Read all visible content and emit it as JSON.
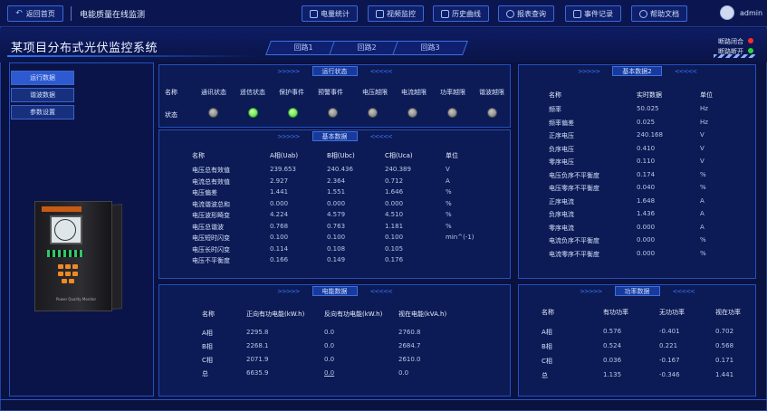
{
  "topbar": {
    "back_label": "返回首页",
    "device_title": "电能质量在线监测",
    "nav": [
      {
        "label": "电量统计",
        "icon": "chart-icon"
      },
      {
        "label": "视频监控",
        "icon": "video-icon"
      },
      {
        "label": "历史曲线",
        "icon": "history-icon"
      },
      {
        "label": "报表查询",
        "icon": "search-icon"
      },
      {
        "label": "事件记录",
        "icon": "document-icon"
      },
      {
        "label": "帮助文档",
        "icon": "help-icon"
      }
    ],
    "user_name": "admin",
    "user_display": "admin"
  },
  "header": {
    "system_title": "某项目分布式光伏监控系统",
    "lines": [
      "回路1",
      "回路2",
      "回路3"
    ],
    "legend": [
      {
        "label": "断路闭合",
        "color": "#ff2b2b"
      },
      {
        "label": "断路断开",
        "color": "#22d93a"
      }
    ]
  },
  "sidebar": {
    "tabs": [
      "运行数据",
      "谐波数据",
      "参数设置"
    ],
    "device_caption": "Power Quality Monitor"
  },
  "status_panel": {
    "title": "运行状态",
    "row_name_label": "名称",
    "row_status_label": "状态",
    "items": [
      {
        "label": "通讯状态",
        "on": false
      },
      {
        "label": "遥信状态",
        "on": true
      },
      {
        "label": "保护事件",
        "on": true
      },
      {
        "label": "预警事件",
        "on": false
      },
      {
        "label": "电压越限",
        "on": false
      },
      {
        "label": "电流越限",
        "on": false
      },
      {
        "label": "功率越限",
        "on": false
      },
      {
        "label": "谐波越限",
        "on": false
      }
    ]
  },
  "basic_panel": {
    "title": "基本数据",
    "headers": [
      "名称",
      "A相(Uab)",
      "B相(Ubc)",
      "C相(Uca)",
      "单位"
    ],
    "rows": [
      [
        "电压总有效值",
        "239.653",
        "240.436",
        "240.389",
        "V"
      ],
      [
        "电流总有效值",
        "2.927",
        "2.364",
        "0.712",
        "A"
      ],
      [
        "电压偏差",
        "1.441",
        "1.551",
        "1.646",
        "%"
      ],
      [
        "电流谐波总和",
        "0.000",
        "0.000",
        "0.000",
        "%"
      ],
      [
        "电压波形畸变",
        "4.224",
        "4.579",
        "4.510",
        "%"
      ],
      [
        "电压总谐波",
        "0.768",
        "0.763",
        "1.181",
        "%"
      ],
      [
        "电压短时闪变",
        "0.100",
        "0.100",
        "0.100",
        "min^(-1)"
      ],
      [
        "电压长时闪变",
        "0.114",
        "0.108",
        "0.105",
        ""
      ],
      [
        "电压不平衡度",
        "0.166",
        "0.149",
        "0.176",
        ""
      ]
    ]
  },
  "energy_panel": {
    "title": "电能数据",
    "headers": [
      "名称",
      "正向有功电能(kW.h)",
      "反向有功电能(kW.h)",
      "视在电能(kVA.h)"
    ],
    "rows": [
      [
        "A相",
        "2295.8",
        "0.0",
        "2760.8"
      ],
      [
        "B相",
        "2268.1",
        "0.0",
        "2684.7"
      ],
      [
        "C相",
        "2071.9",
        "0.0",
        "2610.0"
      ],
      [
        "总",
        "6635.9",
        "0.0",
        "0.0"
      ]
    ]
  },
  "basic2_panel": {
    "title": "基本数据2",
    "headers": [
      "名称",
      "实时数据",
      "单位"
    ],
    "rows": [
      [
        "频率",
        "50.025",
        "Hz"
      ],
      [
        "频率偏差",
        "0.025",
        "Hz"
      ],
      [
        "正序电压",
        "240.168",
        "V"
      ],
      [
        "负序电压",
        "0.410",
        "V"
      ],
      [
        "零序电压",
        "0.110",
        "V"
      ],
      [
        "电压负序不平衡度",
        "0.174",
        "%"
      ],
      [
        "电压零序不平衡度",
        "0.040",
        "%"
      ],
      [
        "正序电流",
        "1.648",
        "A"
      ],
      [
        "负序电流",
        "1.436",
        "A"
      ],
      [
        "零序电流",
        "0.000",
        "A"
      ],
      [
        "电流负序不平衡度",
        "0.000",
        "%"
      ],
      [
        "电流零序不平衡度",
        "0.000",
        "%"
      ]
    ]
  },
  "power_panel": {
    "title": "功率数据",
    "headers": [
      "名称",
      "有功功率",
      "无功功率",
      "视在功率"
    ],
    "rows": [
      [
        "A相",
        "0.576",
        "-0.401",
        "0.702"
      ],
      [
        "B相",
        "0.524",
        "0.221",
        "0.568"
      ],
      [
        "C相",
        "0.036",
        "-0.167",
        "0.171"
      ],
      [
        "总",
        "1.135",
        "-0.346",
        "1.441"
      ]
    ]
  }
}
